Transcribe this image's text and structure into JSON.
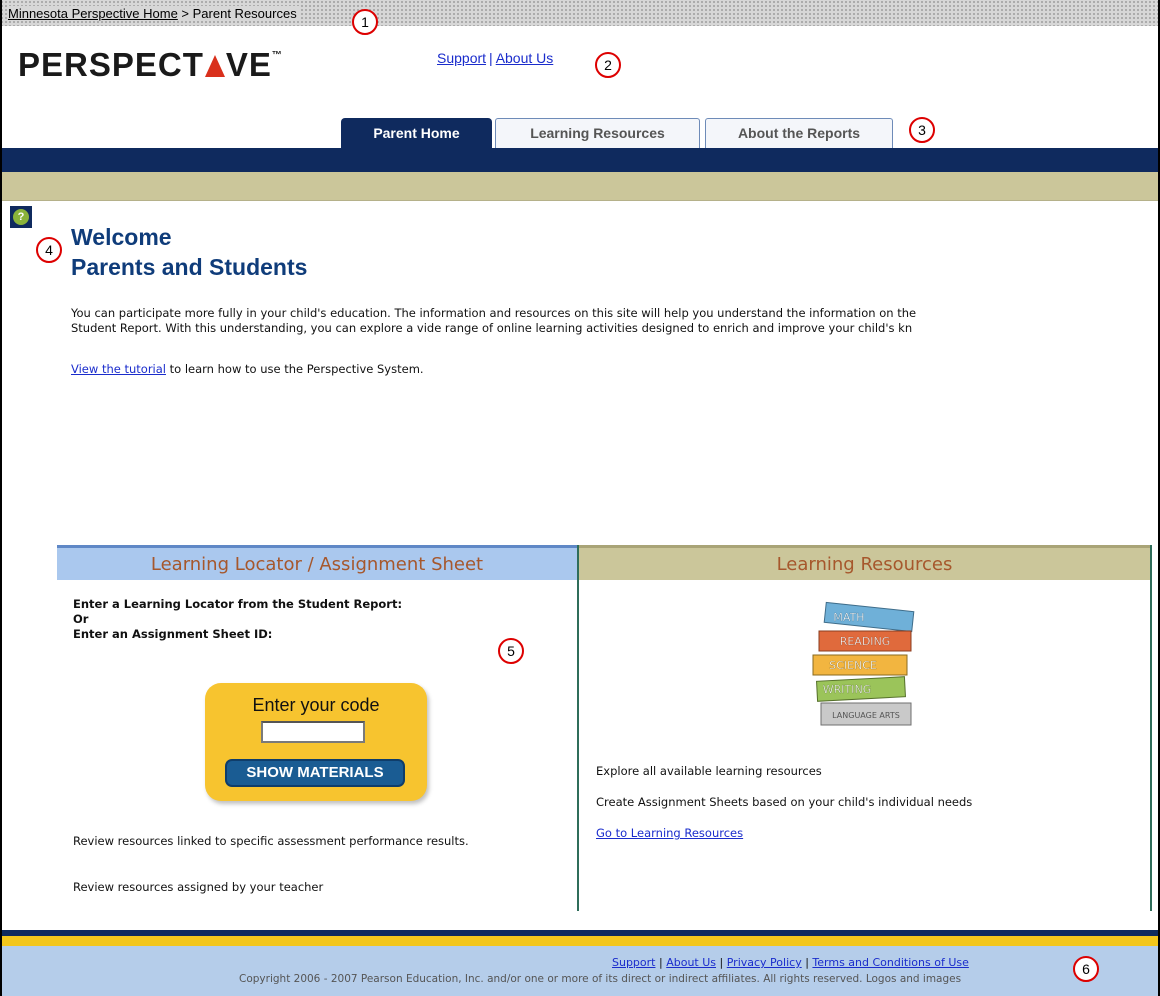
{
  "breadcrumb": {
    "home_link": "Minnesota Perspective Home",
    "separator": " > ",
    "current": "Parent Resources"
  },
  "callouts": [
    "1",
    "2",
    "3",
    "4",
    "5",
    "6"
  ],
  "logo": {
    "left": "PERSPECT",
    "right": "VE",
    "tm": "™"
  },
  "top_links": {
    "support": "Support",
    "sep": "|",
    "about": "About Us"
  },
  "tabs": [
    {
      "label": "Parent Home",
      "active": true
    },
    {
      "label": "Learning Resources",
      "active": false
    },
    {
      "label": "About the Reports",
      "active": false
    }
  ],
  "help_icon": "?",
  "welcome": {
    "line1": "Welcome",
    "line2": "Parents and Students"
  },
  "intro": {
    "line1": "You can participate more fully in your child's education. The information and resources on this site will help you understand the information on the",
    "line2": "Student Report. With this understanding, you can explore a vide range of online learning activities designed to enrich and improve your child's kn"
  },
  "tutorial": {
    "link": "View the tutorial",
    "text": " to learn how to use the Perspective System."
  },
  "left_panel": {
    "title": "Learning Locator / Assignment Sheet",
    "instr1": "Enter a Learning Locator from the Student Report:",
    "instr2": "Or",
    "instr3": "Enter an Assignment Sheet ID:",
    "code_title": "Enter your code",
    "code_value": "",
    "button": "SHOW MATERIALS",
    "note1": "Review resources linked to specific assessment performance results.",
    "note2": "Review resources assigned by your teacher"
  },
  "right_panel": {
    "title": "Learning Resources",
    "books": [
      "MATH",
      "READING",
      "SCIENCE",
      "WRITING",
      "LANGUAGE ARTS"
    ],
    "text1": "Explore all available learning resources",
    "text2": "Create Assignment Sheets based on your child's individual needs",
    "link": "Go to Learning Resources"
  },
  "footer": {
    "links": [
      "Support",
      "About Us",
      "Privacy Policy",
      "Terms and Conditions of Use"
    ],
    "sep": "|",
    "copyright": "Copyright 2006 - 2007 Pearson Education, Inc. and/or one or more of its direct or indirect affiliates. All rights reserved. Logos and images"
  },
  "colors": {
    "navy": "#0f2a5e",
    "khaki": "#cbc69a",
    "gold": "#f7c42f",
    "link": "#1a2ccc",
    "panel_title": "#a6572c"
  }
}
